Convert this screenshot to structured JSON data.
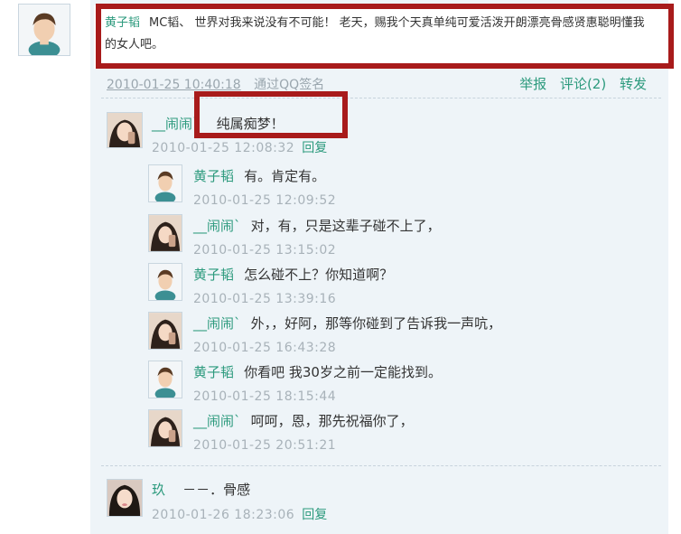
{
  "post": {
    "author": "黄子韬",
    "text": "MC韬、 世界对我来说没有不可能！ 老天，赐我个天真单纯可爱活泼开朗漂亮骨感贤惠聪明懂我的女人吧。",
    "time": "2010-01-25 10:40:18",
    "via": "通过QQ签名",
    "actions": {
      "report": "举报",
      "comment": "评论(2)",
      "forward": "转发"
    }
  },
  "comment1": {
    "author": "__闹闹`",
    "text": "纯属痴梦！",
    "time": "2010-01-25 12:08:32",
    "reply_label": "回复",
    "replies": [
      {
        "author": "黄子韬",
        "text": "有。肯定有。",
        "time": "2010-01-25 12:09:52",
        "avatar": "boy"
      },
      {
        "author": "__闹闹`",
        "text": "对，有，只是这辈子碰不上了，",
        "time": "2010-01-25 13:15:02",
        "avatar": "girl"
      },
      {
        "author": "黄子韬",
        "text": "怎么碰不上？你知道啊？",
        "time": "2010-01-25 13:39:16",
        "avatar": "boy"
      },
      {
        "author": "__闹闹`",
        "text": "外，，好阿，那等你碰到了告诉我一声吭，",
        "time": "2010-01-25 16:43:28",
        "avatar": "girl"
      },
      {
        "author": "黄子韬",
        "text": "你看吧 我30岁之前一定能找到。",
        "time": "2010-01-25 18:15:44",
        "avatar": "boy"
      },
      {
        "author": "__闹闹`",
        "text": "呵呵，恩，那先祝福你了，",
        "time": "2010-01-25 20:51:21",
        "avatar": "girl"
      }
    ]
  },
  "comment2": {
    "author": "玖",
    "text": "－－．骨感",
    "time": "2010-01-26 18:23:06",
    "reply_label": "回复"
  },
  "colors": {
    "accent": "#2c9a7d",
    "highlight": "#a81b1b",
    "panel": "#eef4f8"
  }
}
